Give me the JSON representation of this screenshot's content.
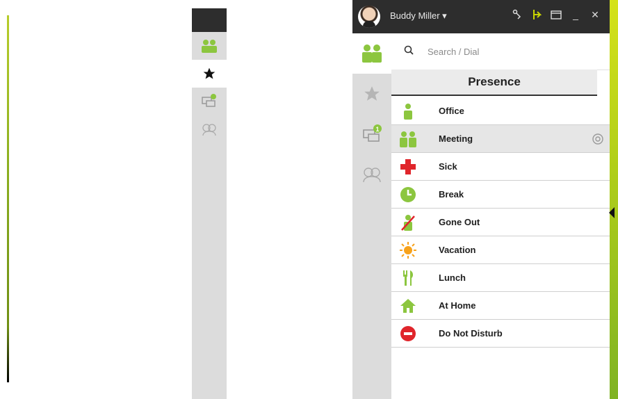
{
  "user": {
    "name": "Buddy Miller ▾"
  },
  "titlebar": {
    "icons": [
      "link-icon",
      "pin-icon",
      "restore-icon",
      "minimize-icon",
      "close-icon"
    ],
    "minimize_glyph": "_",
    "close_glyph": "✕"
  },
  "rail": {
    "items": [
      {
        "name": "contacts",
        "icon": "contacts-icon",
        "active": true
      },
      {
        "name": "favorites",
        "icon": "star-icon",
        "active": false
      },
      {
        "name": "chat",
        "icon": "chat-icon",
        "badge": "1",
        "active": false
      },
      {
        "name": "groups",
        "icon": "groups-icon",
        "active": false
      }
    ]
  },
  "search": {
    "placeholder": "Search / Dial"
  },
  "presence": {
    "title": "Presence",
    "items": [
      {
        "label": "Office",
        "icon": "person-icon"
      },
      {
        "label": "Meeting",
        "icon": "meeting-icon",
        "selected": true
      },
      {
        "label": "Sick",
        "icon": "red-cross-icon"
      },
      {
        "label": "Break",
        "icon": "clock-icon"
      },
      {
        "label": "Gone Out",
        "icon": "gone-out-icon"
      },
      {
        "label": "Vacation",
        "icon": "sun-icon"
      },
      {
        "label": "Lunch",
        "icon": "fork-knife-icon"
      },
      {
        "label": "At Home",
        "icon": "house-icon"
      },
      {
        "label": "Do Not Disturb",
        "icon": "do-not-disturb-icon"
      }
    ]
  },
  "colors": {
    "accent": "#8cc63f",
    "titlebar": "#2d2d2d",
    "rail": "#dcdcdc"
  }
}
